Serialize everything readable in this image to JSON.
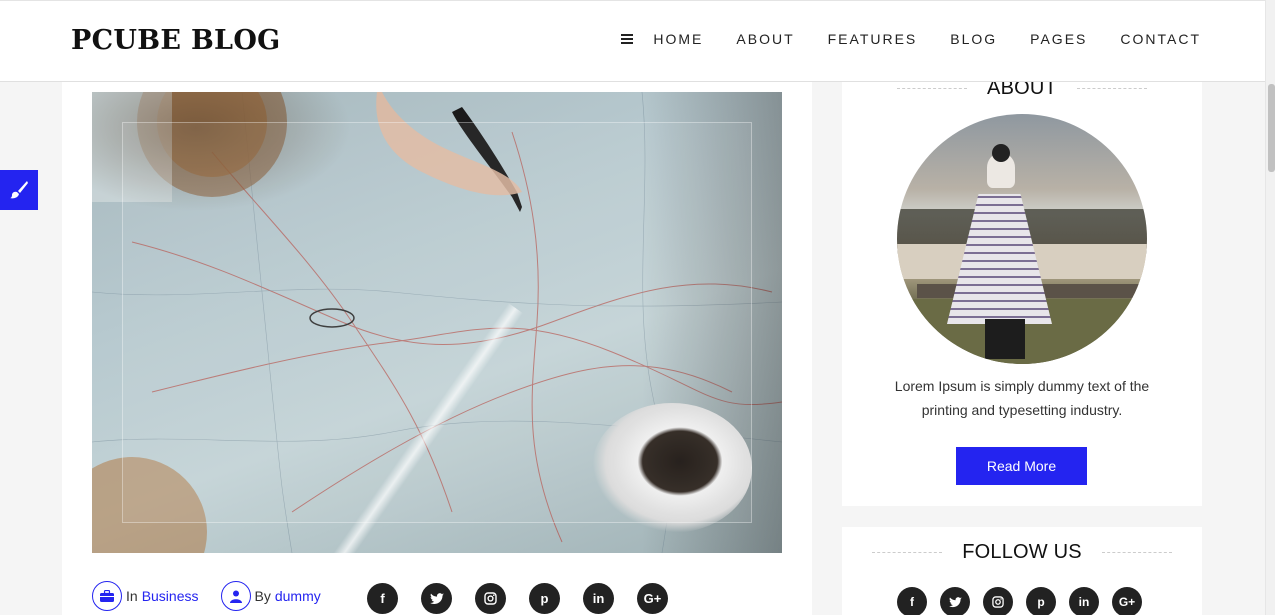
{
  "header": {
    "logo": "PCUBE BLOG",
    "nav": [
      "HOME",
      "ABOUT",
      "FEATURES",
      "BLOG",
      "PAGES",
      "CONTACT"
    ]
  },
  "post": {
    "category_prefix": "In",
    "category": "Business",
    "author_prefix": "By",
    "author": "dummy",
    "social": [
      "f",
      "t",
      "ig",
      "p",
      "in",
      "G+"
    ]
  },
  "about": {
    "title": "ABOUT",
    "text": "Lorem Ipsum is simply dummy text of the printing and typesetting industry.",
    "button": "Read More"
  },
  "follow": {
    "title": "FOLLOW US",
    "social": [
      "f",
      "t",
      "ig",
      "p",
      "in",
      "G+"
    ]
  },
  "colors": {
    "accent": "#2424f0",
    "social_bg": "#222222"
  }
}
